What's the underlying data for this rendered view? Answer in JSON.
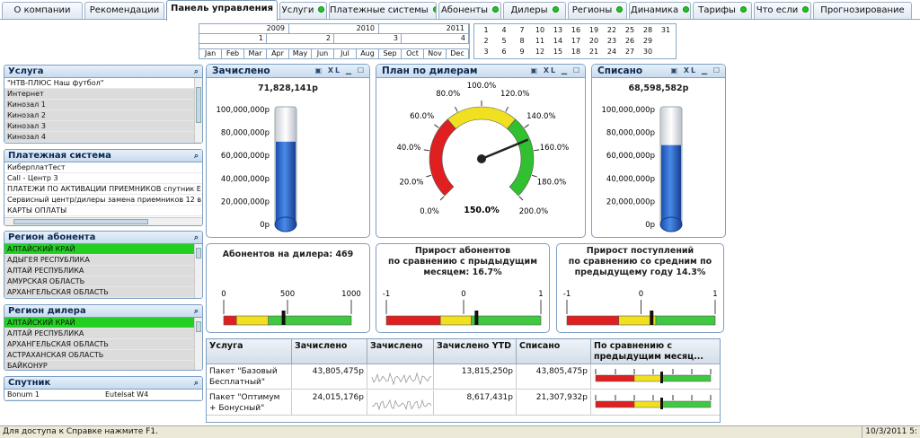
{
  "tabs": [
    {
      "label": "О компании",
      "dot": false
    },
    {
      "label": "Рекомендации",
      "dot": false
    },
    {
      "label": "Панель управления",
      "dot": false,
      "active": true
    },
    {
      "label": "Услуги",
      "dot": true
    },
    {
      "label": "Платежные системы",
      "dot": true
    },
    {
      "label": "Абоненты",
      "dot": true
    },
    {
      "label": "Дилеры",
      "dot": true
    },
    {
      "label": "Регионы",
      "dot": true
    },
    {
      "label": "Динамика",
      "dot": true
    },
    {
      "label": "Тарифы",
      "dot": true
    },
    {
      "label": "Что если",
      "dot": true
    },
    {
      "label": "Прогнозирование",
      "dot": false
    }
  ],
  "timeline": {
    "years": [
      "2009",
      "2010",
      "2011"
    ],
    "quarters": [
      "1",
      "2",
      "3",
      "4"
    ],
    "months": [
      "Jan",
      "Feb",
      "Mar",
      "Apr",
      "May",
      "Jun",
      "Jul",
      "Aug",
      "Sep",
      "Oct",
      "Nov",
      "Dec"
    ]
  },
  "days": [
    [
      "1",
      "4",
      "7",
      "10",
      "13",
      "16",
      "19",
      "22",
      "25",
      "28",
      "31"
    ],
    [
      "2",
      "5",
      "8",
      "11",
      "14",
      "17",
      "20",
      "23",
      "26",
      "29"
    ],
    [
      "3",
      "6",
      "9",
      "12",
      "15",
      "18",
      "21",
      "24",
      "27",
      "30"
    ]
  ],
  "lists": {
    "service": {
      "title": "Услуга",
      "items": [
        [
          "\"НТВ-ПЛЮС Наш футбол\"",
          "w"
        ],
        [
          "Интернет",
          ""
        ],
        [
          "Кинозал 1",
          ""
        ],
        [
          "Кинозал 2",
          ""
        ],
        [
          "Кинозал 3",
          ""
        ],
        [
          "Кинозал 4",
          ""
        ]
      ]
    },
    "payment": {
      "title": "Платежная система",
      "items": [
        [
          "КиберплатТест",
          "w"
        ],
        [
          "Call - Центр 3",
          "w"
        ],
        [
          "ПЛАТЕЖИ ПО АКТИВАЦИИ ПРИЕМНИКОВ спутник Е",
          "w"
        ],
        [
          "Сервисный центр/дилеры замена приемников 12 в",
          "w"
        ],
        [
          "КАРТЫ ОПЛАТЫ",
          "w"
        ]
      ]
    },
    "region_sub": {
      "title": "Регион абонента",
      "items": [
        [
          "АЛТАЙСКИЙ КРАЙ",
          "sel"
        ],
        [
          "АДЫГЕЯ РЕСПУБЛИКА",
          ""
        ],
        [
          "АЛТАЙ РЕСПУБЛИКА",
          ""
        ],
        [
          "АМУРСКАЯ ОБЛАСТЬ",
          ""
        ],
        [
          "АРХАНГЕЛЬСКАЯ ОБЛАСТЬ",
          ""
        ]
      ]
    },
    "region_dealer": {
      "title": "Регион дилера",
      "items": [
        [
          "АЛТАЙСКИЙ КРАЙ",
          "sel"
        ],
        [
          "АЛТАЙ РЕСПУБЛИКА",
          ""
        ],
        [
          "АРХАНГЕЛЬСКАЯ ОБЛАСТЬ",
          ""
        ],
        [
          "АСТРАХАНСКАЯ ОБЛАСТЬ",
          ""
        ],
        [
          "БАЙКОНУР",
          ""
        ]
      ]
    },
    "satellite": {
      "title": "Спутник",
      "item1": "Bonum 1",
      "item2": "Eutelsat W4"
    }
  },
  "accrued": {
    "title": "Зачислено",
    "value": "71,828,141р",
    "ticks": [
      "100,000,000р",
      "80,000,000р",
      "60,000,000р",
      "40,000,000р",
      "20,000,000р",
      "0р"
    ],
    "level": 0.72
  },
  "written": {
    "title": "Списано",
    "value": "68,598,582р",
    "ticks": [
      "100,000,000р",
      "80,000,000р",
      "60,000,000р",
      "40,000,000р",
      "20,000,000р",
      "0р"
    ],
    "level": 0.69
  },
  "plan": {
    "title": "План по дилерам",
    "labels": [
      "0.0%",
      "20.0%",
      "40.0%",
      "60.0%",
      "80.0%",
      "100.0%",
      "120.0%",
      "140.0%",
      "160.0%",
      "180.0%",
      "200.0%"
    ],
    "value_label": "150.0%",
    "value": 150
  },
  "icons": {
    "print": "print-icon",
    "xl": "XL",
    "min": "minimize-icon",
    "search": "search-icon"
  },
  "kpi1": {
    "title": "Абонентов на дилера: 469",
    "ticks": [
      "0",
      "500",
      "1000"
    ],
    "value": 469
  },
  "kpi2": {
    "title": "Прирост абонентов\nпо сравнению с прыдыдущим\nмесяцем: 16.7%",
    "ticks": [
      "-1",
      "0",
      "1"
    ],
    "value": 0.167
  },
  "kpi3": {
    "title": "Прирост поступлений\nпо сравнению со средним по\nпредыдущему году 14.3%",
    "ticks": [
      "-1",
      "0",
      "1"
    ],
    "value": 0.143
  },
  "table": {
    "headers": [
      "Услуга",
      "Зачислено",
      "Зачислено",
      "Зачислено YTD",
      "Списано",
      "По сравнению с предыдущим месяц..."
    ],
    "rows": [
      {
        "service": "Пакет \"Базовый Бесплатный\"",
        "accrued": "43,805,475р",
        "ytd": "13,815,250р",
        "written": "43,805,475р"
      },
      {
        "service": "Пакет \"Оптимум + Бонусный\"",
        "accrued": "24,015,176р",
        "ytd": "8,617,431р",
        "written": "21,307,932р"
      }
    ]
  },
  "status": {
    "help": "Для доступа к Справке нажмите F1.",
    "date": "10/3/2011 5:"
  }
}
